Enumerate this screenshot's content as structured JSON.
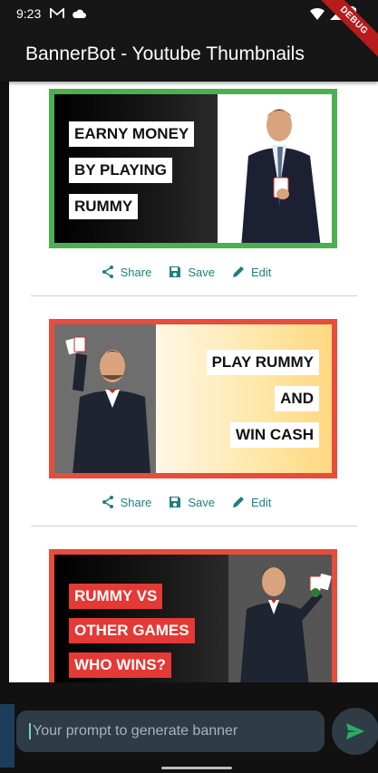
{
  "status": {
    "time": "9:23",
    "debug_label": "DEBUG"
  },
  "app": {
    "title": "BannerBot - Youtube Thumbnails"
  },
  "banners": [
    {
      "lines": [
        "EARNY MONEY",
        "BY PLAYING",
        "RUMMY"
      ],
      "border_color": "#4caf50"
    },
    {
      "lines": [
        "PLAY RUMMY",
        "AND",
        "WIN CASH"
      ],
      "border_color": "#e74c3c"
    },
    {
      "lines": [
        "RUMMY VS",
        "OTHER GAMES",
        "WHO WINS?"
      ],
      "border_color": "#e74c3c"
    }
  ],
  "actions": {
    "share": "Share",
    "save": "Save",
    "edit": "Edit"
  },
  "prompt": {
    "placeholder": "Your prompt to generate banner"
  },
  "colors": {
    "accent": "#1e7f7f",
    "appbar": "#161616"
  }
}
